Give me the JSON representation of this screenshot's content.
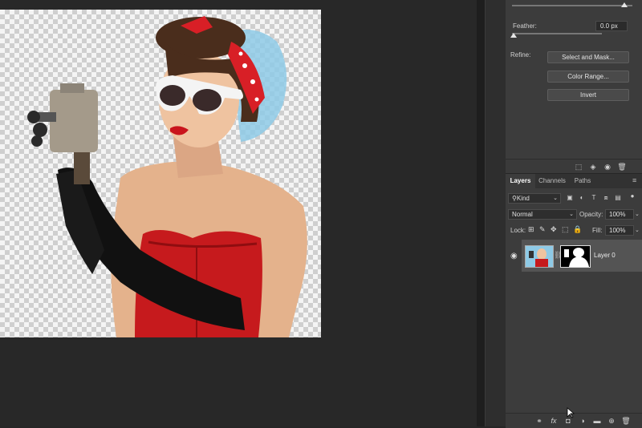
{
  "properties": {
    "feather_label": "Feather:",
    "feather_value": "0.0 px",
    "refine_label": "Refine:",
    "select_mask_button": "Select and Mask...",
    "color_range_button": "Color Range...",
    "invert_button": "Invert"
  },
  "layers": {
    "tabs": [
      "Layers",
      "Channels",
      "Paths"
    ],
    "active_tab": "Layers",
    "filter_kind": "Kind",
    "blend_mode": "Normal",
    "opacity_label": "Opacity:",
    "opacity_value": "100%",
    "lock_label": "Lock:",
    "fill_label": "Fill:",
    "fill_value": "100%",
    "layer_name": "Layer 0"
  },
  "icons": {
    "visibility": "eye-icon",
    "chain": "link-icon",
    "fx": "fx",
    "fx_label": "fx"
  },
  "colors": {
    "panel_bg": "#3c3c3c",
    "workspace_bg": "#282828",
    "selected_layer": "#545454"
  }
}
